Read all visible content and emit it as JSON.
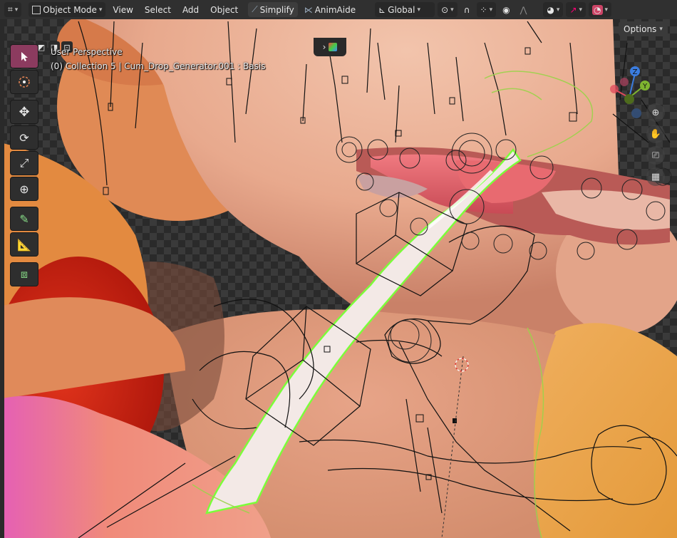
{
  "header": {
    "mode": "Object Mode",
    "menus": [
      "View",
      "Select",
      "Add",
      "Object"
    ],
    "addons": [
      "Simplify",
      "AnimAide"
    ],
    "orientation": "Global"
  },
  "viewport": {
    "perspective_label": "User Perspective",
    "object_label": "(0) Collection 5 | Cum_Drop_Generator.001 : Basis",
    "options_label": "Options"
  },
  "gizmo": {
    "z": "Z",
    "y": "Y"
  },
  "colors": {
    "accent": "#8c3b5f",
    "header": "#303030",
    "x_axis": "#e04a5b",
    "y_axis": "#7fb530",
    "z_axis": "#3b7de0"
  }
}
